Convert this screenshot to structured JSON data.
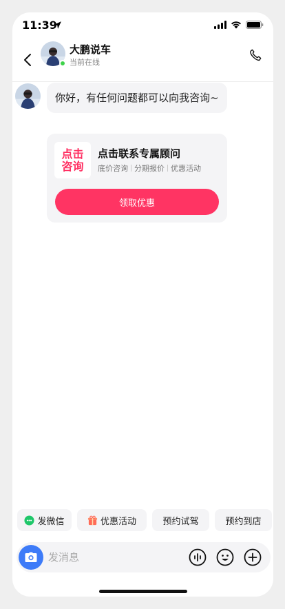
{
  "status_bar": {
    "time": "11:39"
  },
  "header": {
    "contact_name": "大鹏说车",
    "presence": "当前在线"
  },
  "chat": {
    "greeting": "你好，有任何问题都可以向我咨询~",
    "card": {
      "logo_line1": "点击",
      "logo_line2": "咨询",
      "title": "点击联系专属顾问",
      "tags": [
        "底价咨询",
        "分期报价",
        "优惠活动"
      ],
      "cta_label": "领取优惠"
    }
  },
  "quick_actions": [
    {
      "label": "发微信",
      "icon": "wechat-icon"
    },
    {
      "label": "优惠活动",
      "icon": "gift-icon"
    },
    {
      "label": "预约试驾",
      "icon": ""
    },
    {
      "label": "预约到店",
      "icon": ""
    }
  ],
  "input": {
    "placeholder": "发消息"
  },
  "colors": {
    "accent": "#ff3463",
    "camera": "#3d7bf8",
    "online": "#3ed24a"
  }
}
